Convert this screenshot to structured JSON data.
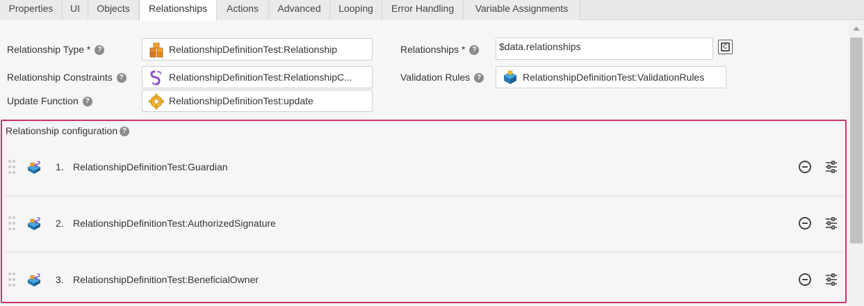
{
  "tabs": [
    {
      "label": "Properties",
      "active": false
    },
    {
      "label": "UI",
      "active": false
    },
    {
      "label": "Objects",
      "active": false
    },
    {
      "label": "Relationships",
      "active": true
    },
    {
      "label": "Actions",
      "active": false
    },
    {
      "label": "Advanced",
      "active": false
    },
    {
      "label": "Looping",
      "active": false
    },
    {
      "label": "Error Handling",
      "active": false
    },
    {
      "label": "Variable Assignments",
      "active": false
    }
  ],
  "form": {
    "relationship_type": {
      "label": "Relationship Type *",
      "value": "RelationshipDefinitionTest:Relationship",
      "icon": "cubes-icon"
    },
    "relationship_constraints": {
      "label": "Relationship Constraints",
      "value": "RelationshipDefinitionTest:RelationshipC...",
      "icon": "constraint-icon"
    },
    "update_function": {
      "label": "Update Function",
      "value": "RelationshipDefinitionTest:update",
      "icon": "gear-icon"
    },
    "relationships": {
      "label": "Relationships *",
      "value": "$data.relationships"
    },
    "validation_rules": {
      "label": "Validation Rules",
      "value": "RelationshipDefinitionTest:ValidationRules",
      "icon": "blocks-icon"
    },
    "help_glyph": "?",
    "expression_glyph": "C"
  },
  "config": {
    "title": "Relationship configuration",
    "items": [
      {
        "number": "1.",
        "label": "RelationshipDefinitionTest:Guardian"
      },
      {
        "number": "2.",
        "label": "RelationshipDefinitionTest:AuthorizedSignature"
      },
      {
        "number": "3.",
        "label": "RelationshipDefinitionTest:BeneficialOwner"
      }
    ]
  },
  "colors": {
    "accent_border": "#c8336a",
    "active_tab": "#ffffff"
  }
}
